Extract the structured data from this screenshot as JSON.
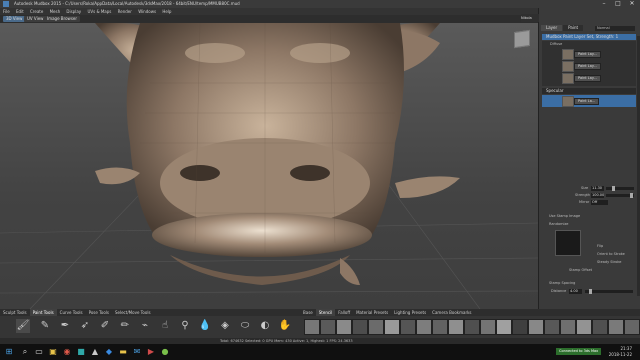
{
  "window": {
    "title": "Autodesk Mudbox 2015 - C:/Users/Roka/AppData/Local/Autodesk/3dsMax/2018 - 64bit/ENU/temp/MMUB80C.mud",
    "minimize": "–",
    "maximize": "□",
    "close": "✕"
  },
  "menu": [
    "File",
    "Edit",
    "Create",
    "Mesh",
    "Display",
    "UVs & Maps",
    "Render",
    "Windows",
    "Help"
  ],
  "view_tabs": [
    "3D View",
    "UV View",
    "Image Browser"
  ],
  "right_panel": {
    "user": "Nikola",
    "tabs": [
      "Layer",
      "Paint"
    ],
    "active_tab": "Paint",
    "dropdown": "Normal",
    "layer_header": "Mudbox Paint Layer Set, Strength: 1",
    "diffuse_label": "Diffuse",
    "paint_layers": [
      "Paint Lay...",
      "Paint Lay...",
      "Paint Lay..."
    ],
    "specular_label": "Specular",
    "specular_layer": "Paint La...",
    "properties": {
      "size_label": "Size",
      "size_value": "11.30",
      "strength_label": "Strength",
      "strength_value": "100.00",
      "mirror_label": "Mirror",
      "mirror_value": "Off",
      "use_stamp_label": "Use Stamp Image",
      "stamp_spacing_label": "Stamp Spacing",
      "distance_label": "Distance",
      "distance_value": "4.00",
      "orient_label": "Orient to Stroke",
      "randomize_label": "Randomize",
      "flip_label": "Flip",
      "steady_label": "Steady Stroke",
      "stamp_offset_label": "Stamp Offset"
    }
  },
  "bottom_tabs": [
    "Sculpt Tools",
    "Paint Tools",
    "Curve Tools",
    "Pose Tools",
    "Select/Move Tools"
  ],
  "active_bottom_tab": "Paint Tools",
  "paint_tools": [
    "brush",
    "pencil",
    "pen",
    "airbrush",
    "eraser",
    "dry brush",
    "clone",
    "smudge",
    "eyedropper",
    "blur",
    "fill",
    "sponge",
    "dodge",
    "burn",
    "projection"
  ],
  "stamp_tabs": [
    "Base",
    "Stencil",
    "Falloff",
    "Material Presets",
    "Lighting Presets",
    "Camera Bookmarks"
  ],
  "active_stamp_tab": "Stencil",
  "status": {
    "text": "Total: 674632   Selected: 0   GPU Mem: 430   Active: 1, Highest: 1   FPS: 24.3633"
  },
  "taskbar": {
    "notification": "Connected to 3ds Max",
    "time": "21:37",
    "date": "2018-11-22",
    "icons": [
      "windows-icon",
      "search-icon",
      "task-view-icon",
      "explorer-icon",
      "chrome-icon",
      "max-icon",
      "mudbox-icon",
      "photoshop-icon",
      "folder-icon",
      "mail-icon",
      "media-icon",
      "app-icon"
    ]
  },
  "colors": {
    "model": "#8a7665",
    "accent": "#4a7fb5",
    "active_layer": "#3b6ea5"
  }
}
